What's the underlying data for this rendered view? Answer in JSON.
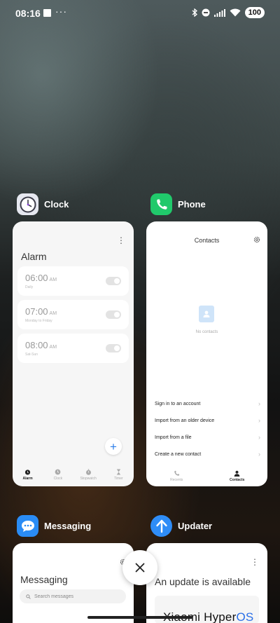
{
  "status_bar": {
    "time": "08:16",
    "more": "···",
    "battery": "100"
  },
  "apps": [
    {
      "name": "Clock",
      "icon": "clock-icon",
      "menu": "⋮",
      "title": "Alarm",
      "alarms": [
        {
          "time": "06:00",
          "ampm": "AM",
          "sub": "Daily"
        },
        {
          "time": "07:00",
          "ampm": "AM",
          "sub": "Monday to Friday"
        },
        {
          "time": "08:00",
          "ampm": "AM",
          "sub": "Sat-Sun"
        }
      ],
      "add": "+",
      "nav": [
        "Alarm",
        "Clock",
        "Stopwatch",
        "Timer"
      ]
    },
    {
      "name": "Phone",
      "icon": "phone-icon",
      "title": "Contacts",
      "empty_text": "No contacts",
      "options": [
        "Sign in to an account",
        "Import from an older device",
        "Import from a file",
        "Create a new contact"
      ],
      "nav": [
        "Recents",
        "Contacts"
      ]
    },
    {
      "name": "Messaging",
      "icon": "chat-bubble-icon",
      "title": "Messaging",
      "search_placeholder": "Search messages"
    },
    {
      "name": "Updater",
      "icon": "arrow-up-icon",
      "menu": "⋮",
      "title": "An update is available",
      "logo_brand": "Xiaomi Hyper",
      "logo_os": "OS"
    }
  ],
  "colors": {
    "clock_icon_bg": "#e6e8f0",
    "phone_icon_bg": "#20c96b",
    "messaging_icon_bg": "#2a8cf5",
    "updater_icon_bg": "#2f8df7",
    "accent_blue": "#2b7de9"
  }
}
